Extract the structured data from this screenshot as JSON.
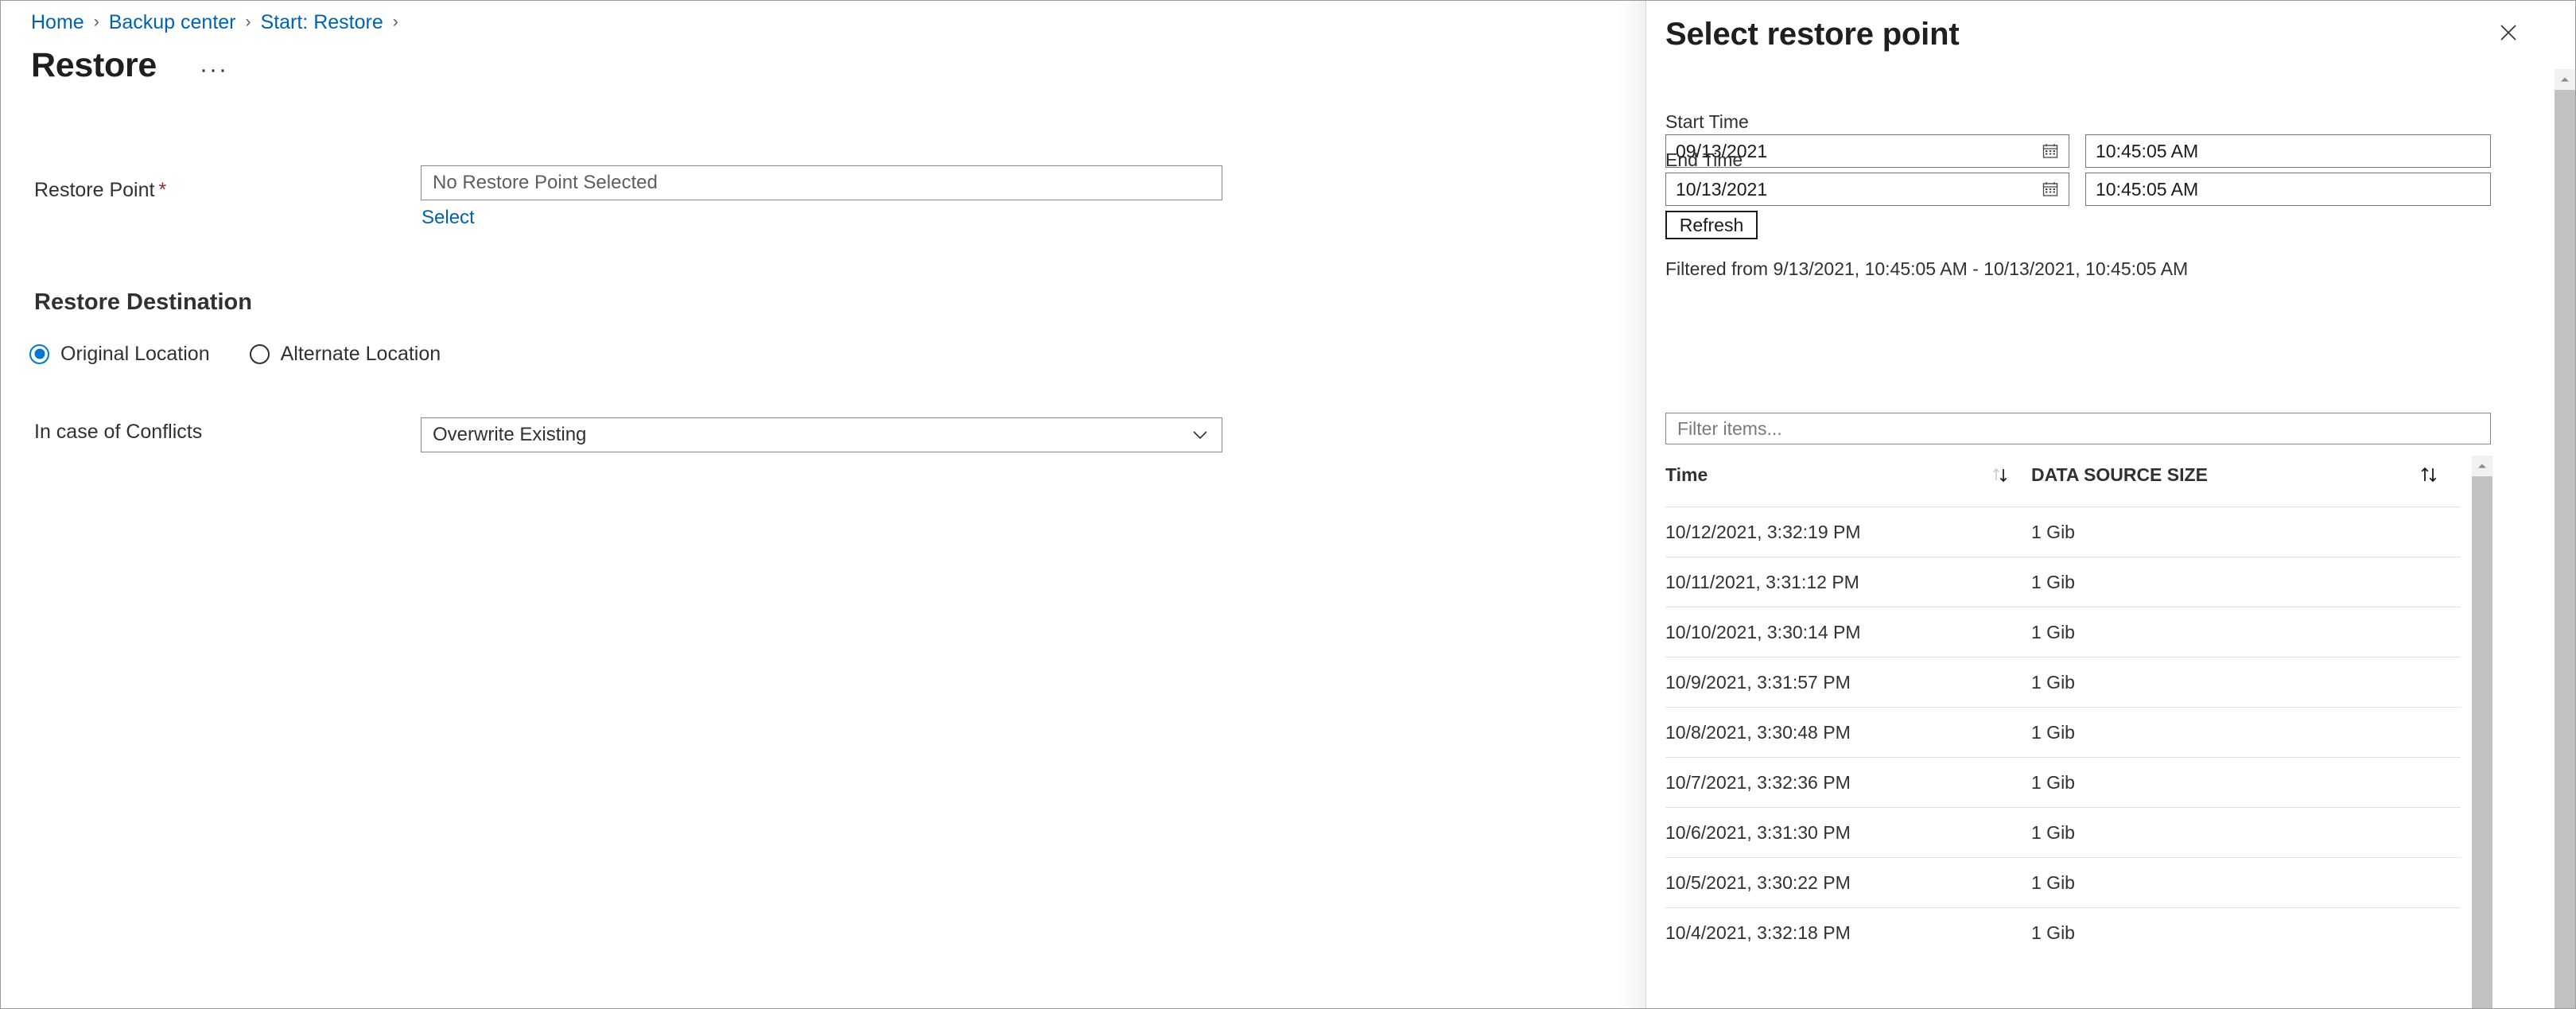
{
  "breadcrumb": {
    "items": [
      {
        "label": "Home"
      },
      {
        "label": "Backup center"
      },
      {
        "label": "Start: Restore"
      }
    ],
    "separator": "›"
  },
  "page": {
    "title": "Restore",
    "more_label": "···"
  },
  "form": {
    "restore_point_label": "Restore Point",
    "required_mark": "*",
    "restore_point_value": "No Restore Point Selected",
    "select_link": "Select",
    "destination_heading": "Restore Destination",
    "destination_options": [
      {
        "label": "Original Location",
        "selected": true
      },
      {
        "label": "Alternate Location",
        "selected": false
      }
    ],
    "conflicts_label": "In case of Conflicts",
    "conflicts_value": "Overwrite Existing"
  },
  "panel": {
    "title": "Select restore point",
    "close_icon": "close-icon",
    "start_time_label": "Start Time",
    "start_date_value": "09/13/2021",
    "start_time_value": "10:45:05 AM",
    "end_time_label": "End Time",
    "end_date_value": "10/13/2021",
    "end_time_value": "10:45:05 AM",
    "calendar_icon": "calendar-icon",
    "refresh_label": "Refresh",
    "filtered_note": "Filtered from 9/13/2021, 10:45:05 AM - 10/13/2021, 10:45:05 AM",
    "filter_placeholder": "Filter items...",
    "filter_value": ""
  },
  "table": {
    "columns": [
      {
        "label": "Time",
        "sort_icon": "sort-ascending-descending-icon"
      },
      {
        "label": "DATA SOURCE SIZE",
        "sort_icon": "sort-ascending-descending-icon"
      }
    ],
    "rows": [
      {
        "time": "10/12/2021, 3:32:19 PM",
        "size": "1  Gib"
      },
      {
        "time": "10/11/2021, 3:31:12 PM",
        "size": "1  Gib"
      },
      {
        "time": "10/10/2021, 3:30:14 PM",
        "size": "1  Gib"
      },
      {
        "time": "10/9/2021, 3:31:57 PM",
        "size": "1  Gib"
      },
      {
        "time": "10/8/2021, 3:30:48 PM",
        "size": "1  Gib"
      },
      {
        "time": "10/7/2021, 3:32:36 PM",
        "size": "1  Gib"
      },
      {
        "time": "10/6/2021, 3:31:30 PM",
        "size": "1  Gib"
      },
      {
        "time": "10/5/2021, 3:30:22 PM",
        "size": "1  Gib"
      },
      {
        "time": "10/4/2021, 3:32:18 PM",
        "size": "1  Gib"
      }
    ]
  },
  "colors": {
    "link": "#0063b1",
    "accent": "#0078d4",
    "required": "#a4262c",
    "text": "#323130",
    "border": "#8a8886",
    "scrollbar_thumb": "#c1c1c1"
  }
}
